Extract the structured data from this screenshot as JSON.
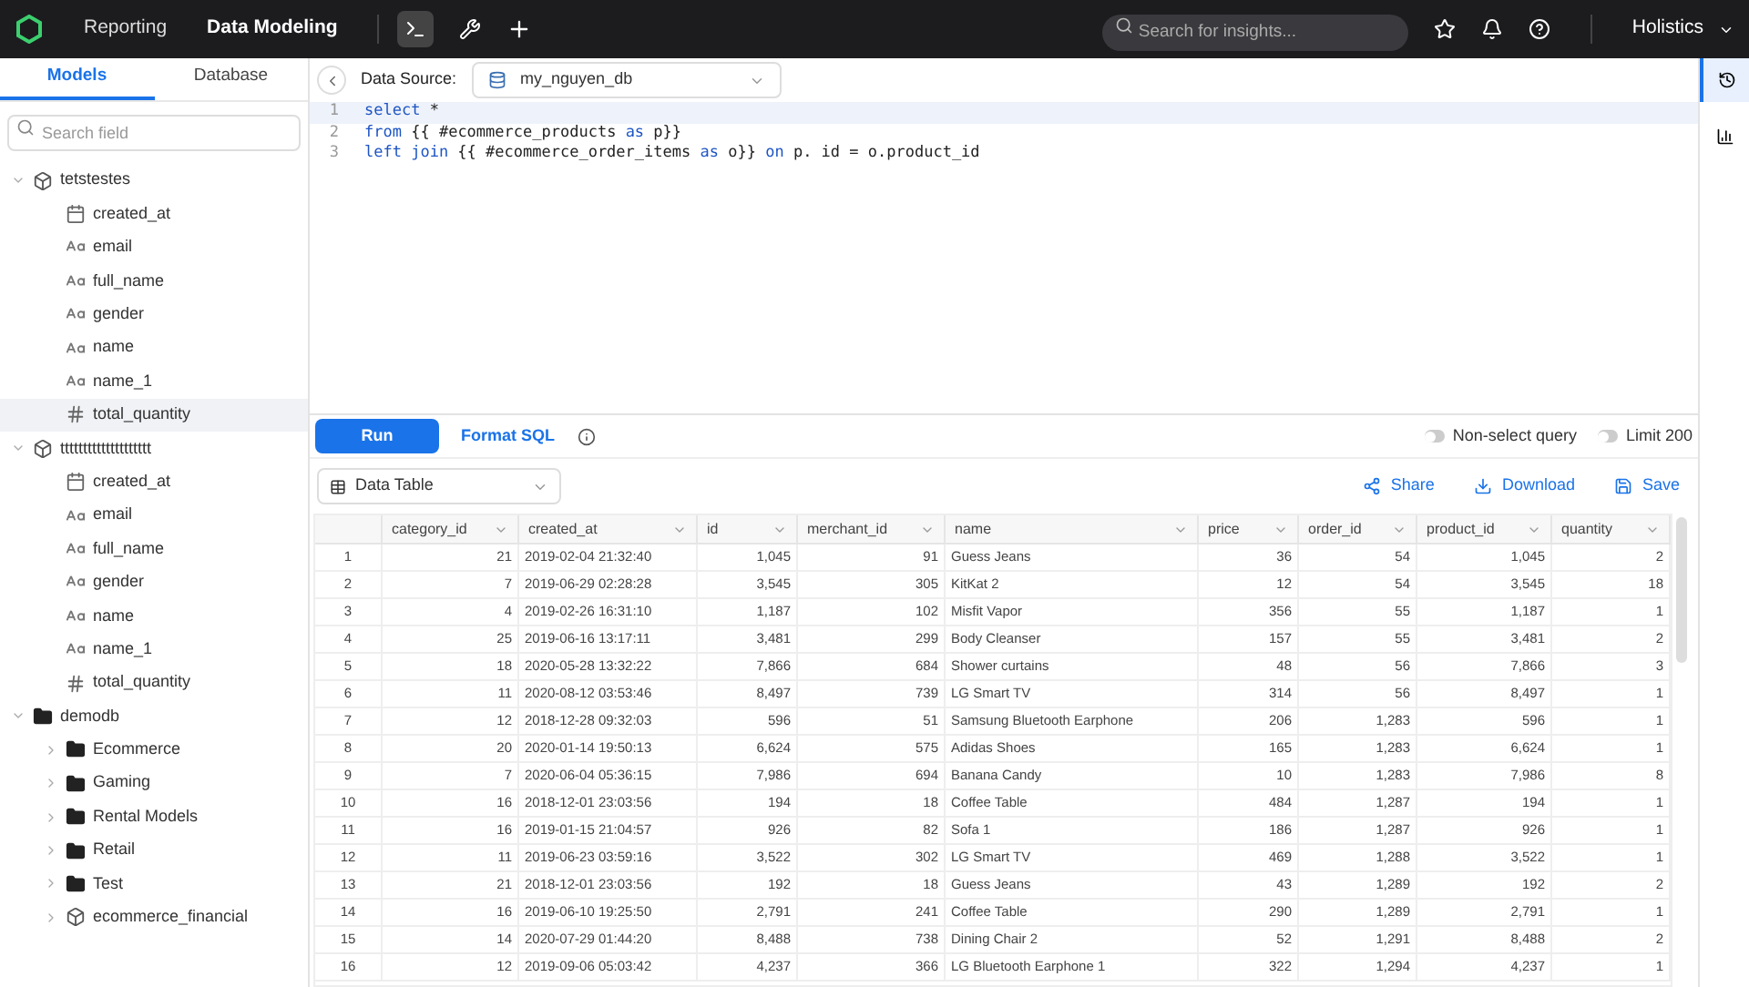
{
  "topbar": {
    "nav": [
      {
        "label": "Reporting",
        "selected": false
      },
      {
        "label": "Data Modeling",
        "selected": true
      }
    ],
    "search": {
      "placeholder": "Search for insights..."
    },
    "account": "Holistics"
  },
  "sidebar": {
    "tabs": [
      {
        "label": "Models",
        "selected": true
      },
      {
        "label": "Database",
        "selected": false
      }
    ],
    "search": {
      "placeholder": "Search field"
    },
    "tree": [
      {
        "label": "tetstestes",
        "kind": "model",
        "expanded": true,
        "selected": false,
        "children": [
          {
            "label": "created_at",
            "kind": "date",
            "selected": false
          },
          {
            "label": "email",
            "kind": "text",
            "selected": false
          },
          {
            "label": "full_name",
            "kind": "text",
            "selected": false
          },
          {
            "label": "gender",
            "kind": "text",
            "selected": false
          },
          {
            "label": "name",
            "kind": "text",
            "selected": false
          },
          {
            "label": "name_1",
            "kind": "text",
            "selected": false
          },
          {
            "label": "total_quantity",
            "kind": "number",
            "selected": true
          }
        ]
      },
      {
        "label": "tttttttttttttttttttt",
        "kind": "model",
        "expanded": true,
        "selected": false,
        "children": [
          {
            "label": "created_at",
            "kind": "date",
            "selected": false
          },
          {
            "label": "email",
            "kind": "text",
            "selected": false
          },
          {
            "label": "full_name",
            "kind": "text",
            "selected": false
          },
          {
            "label": "gender",
            "kind": "text",
            "selected": false
          },
          {
            "label": "name",
            "kind": "text",
            "selected": false
          },
          {
            "label": "name_1",
            "kind": "text",
            "selected": false
          },
          {
            "label": "total_quantity",
            "kind": "number",
            "selected": false
          }
        ]
      },
      {
        "label": "demodb",
        "kind": "folder",
        "expanded": true,
        "selected": false,
        "children": [
          {
            "label": "Ecommerce",
            "kind": "folder",
            "expanded": false,
            "selected": false
          },
          {
            "label": "Gaming",
            "kind": "folder",
            "expanded": false,
            "selected": false
          },
          {
            "label": "Rental Models",
            "kind": "folder",
            "expanded": false,
            "selected": false
          },
          {
            "label": "Retail",
            "kind": "folder",
            "expanded": false,
            "selected": false
          },
          {
            "label": "Test",
            "kind": "folder",
            "expanded": false,
            "selected": false
          },
          {
            "label": "ecommerce_financial",
            "kind": "model",
            "expanded": false,
            "selected": false
          }
        ]
      }
    ]
  },
  "editor": {
    "data_source_label": "Data Source:",
    "data_source": "my_nguyen_db",
    "lines": [
      {
        "number": "1",
        "tokens": [
          {
            "kind": "keyword",
            "text": "select"
          },
          {
            "kind": "plain",
            "text": " *"
          }
        ]
      },
      {
        "number": "2",
        "tokens": [
          {
            "kind": "keyword",
            "text": "from"
          },
          {
            "kind": "plain",
            "text": " {{ #ecommerce_products "
          },
          {
            "kind": "keyword",
            "text": "as"
          },
          {
            "kind": "plain",
            "text": " p}}"
          }
        ]
      },
      {
        "number": "3",
        "tokens": [
          {
            "kind": "keyword",
            "text": "left join"
          },
          {
            "kind": "plain",
            "text": " {{ #ecommerce_order_items "
          },
          {
            "kind": "keyword",
            "text": "as"
          },
          {
            "kind": "plain",
            "text": " o}} "
          },
          {
            "kind": "keyword",
            "text": "on"
          },
          {
            "kind": "plain",
            "text": " p. id = o.product_id"
          }
        ]
      }
    ]
  },
  "toolbar": {
    "run": "Run",
    "format": "Format SQL",
    "toggles": [
      {
        "label": "Non-select query",
        "on": false
      },
      {
        "label": "Limit 200",
        "on": false
      }
    ]
  },
  "results": {
    "view": "Data Table",
    "actions": [
      {
        "label": "Share",
        "kind": "share"
      },
      {
        "label": "Download",
        "kind": "download"
      },
      {
        "label": "Save",
        "kind": "save"
      }
    ],
    "columns": [
      "category_id",
      "created_at",
      "id",
      "merchant_id",
      "name",
      "price",
      "order_id",
      "product_id",
      "quantity"
    ],
    "rows": [
      {
        "number": "1",
        "cells": [
          "21",
          "2019-02-04 21:32:40",
          "1,045",
          "91",
          "Guess Jeans",
          "36",
          "54",
          "1,045",
          "2"
        ]
      },
      {
        "number": "2",
        "cells": [
          "7",
          "2019-06-29 02:28:28",
          "3,545",
          "305",
          "KitKat 2",
          "12",
          "54",
          "3,545",
          "18"
        ]
      },
      {
        "number": "3",
        "cells": [
          "4",
          "2019-02-26 16:31:10",
          "1,187",
          "102",
          "Misfit Vapor",
          "356",
          "55",
          "1,187",
          "1"
        ]
      },
      {
        "number": "4",
        "cells": [
          "25",
          "2019-06-16 13:17:11",
          "3,481",
          "299",
          "Body Cleanser",
          "157",
          "55",
          "3,481",
          "2"
        ]
      },
      {
        "number": "5",
        "cells": [
          "18",
          "2020-05-28 13:32:22",
          "7,866",
          "684",
          "Shower curtains",
          "48",
          "56",
          "7,866",
          "3"
        ]
      },
      {
        "number": "6",
        "cells": [
          "11",
          "2020-08-12 03:53:46",
          "8,497",
          "739",
          "LG Smart TV",
          "314",
          "56",
          "8,497",
          "1"
        ]
      },
      {
        "number": "7",
        "cells": [
          "12",
          "2018-12-28 09:32:03",
          "596",
          "51",
          "Samsung Bluetooth Earphone",
          "206",
          "1,283",
          "596",
          "1"
        ]
      },
      {
        "number": "8",
        "cells": [
          "20",
          "2020-01-14 19:50:13",
          "6,624",
          "575",
          "Adidas Shoes",
          "165",
          "1,283",
          "6,624",
          "1"
        ]
      },
      {
        "number": "9",
        "cells": [
          "7",
          "2020-06-04 05:36:15",
          "7,986",
          "694",
          "Banana Candy",
          "10",
          "1,283",
          "7,986",
          "8"
        ]
      },
      {
        "number": "10",
        "cells": [
          "16",
          "2018-12-01 23:03:56",
          "194",
          "18",
          "Coffee Table",
          "484",
          "1,287",
          "194",
          "1"
        ]
      },
      {
        "number": "11",
        "cells": [
          "16",
          "2019-01-15 21:04:57",
          "926",
          "82",
          "Sofa 1",
          "186",
          "1,287",
          "926",
          "1"
        ]
      },
      {
        "number": "12",
        "cells": [
          "11",
          "2019-06-23 03:59:16",
          "3,522",
          "302",
          "LG Smart TV",
          "469",
          "1,288",
          "3,522",
          "1"
        ]
      },
      {
        "number": "13",
        "cells": [
          "21",
          "2018-12-01 23:03:56",
          "192",
          "18",
          "Guess Jeans",
          "43",
          "1,289",
          "192",
          "2"
        ]
      },
      {
        "number": "14",
        "cells": [
          "16",
          "2019-06-10 19:25:50",
          "2,791",
          "241",
          "Coffee Table",
          "290",
          "1,289",
          "2,791",
          "1"
        ]
      },
      {
        "number": "15",
        "cells": [
          "14",
          "2020-07-29 01:44:20",
          "8,488",
          "738",
          "Dining Chair 2",
          "52",
          "1,291",
          "8,488",
          "2"
        ]
      },
      {
        "number": "16",
        "cells": [
          "12",
          "2019-09-06 05:03:42",
          "4,237",
          "366",
          "LG Bluetooth Earphone 1",
          "322",
          "1,294",
          "4,237",
          "1"
        ]
      }
    ]
  }
}
